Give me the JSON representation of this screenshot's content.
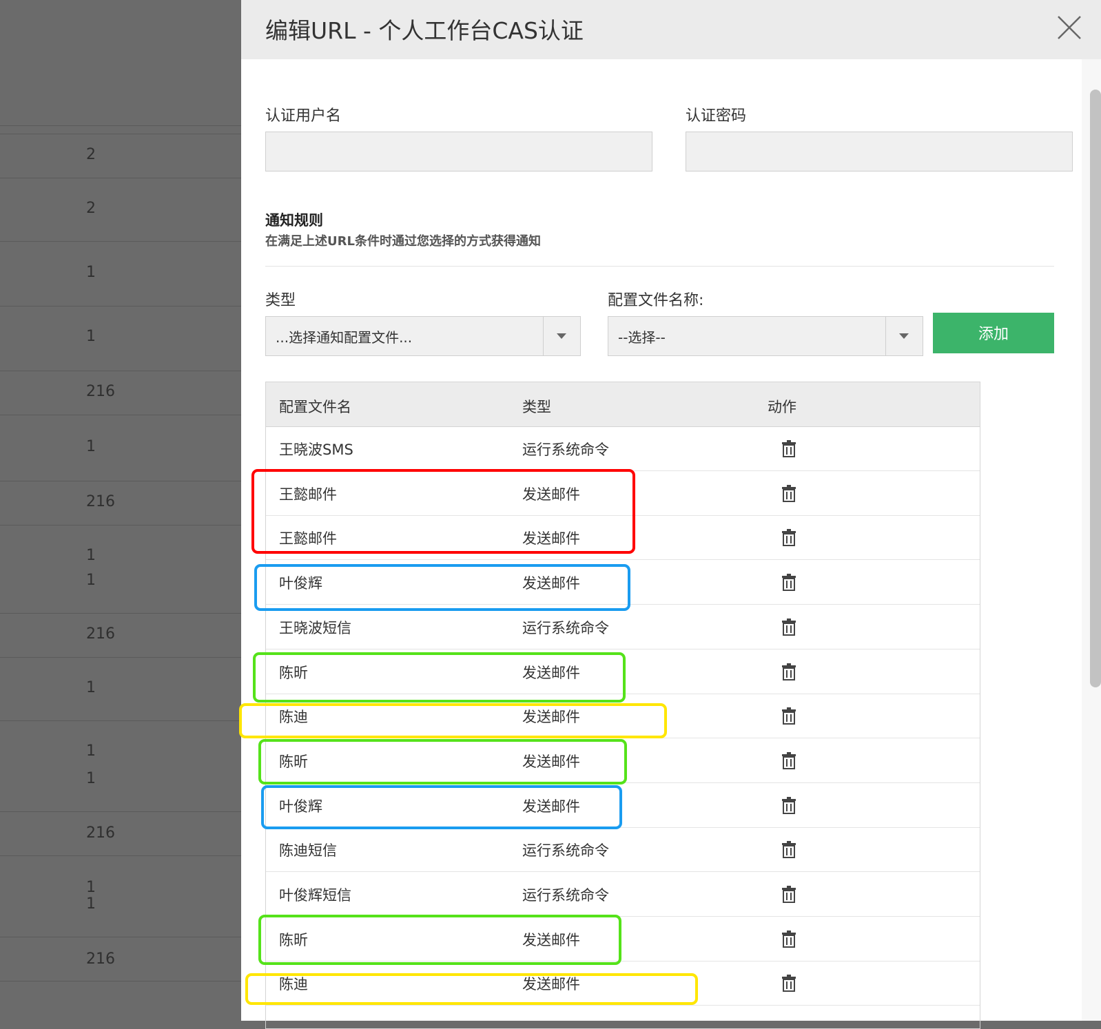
{
  "background": {
    "values": [
      "2",
      "2",
      "1",
      "1",
      "216",
      "1",
      "216",
      "1",
      "1",
      "216",
      "1",
      "1",
      "1",
      "216",
      "1",
      "1",
      "216"
    ]
  },
  "modal": {
    "title": "编辑URL - 个人工作台CAS认证",
    "close_icon": "close-icon"
  },
  "auth": {
    "username_label": "认证用户名",
    "username_value": "",
    "password_label": "认证密码",
    "password_value": ""
  },
  "notify": {
    "title": "通知规则",
    "description": "在满足上述URL条件时通过您选择的方式获得通知",
    "type_label": "类型",
    "type_selected": "...选择通知配置文件...",
    "profile_label": "配置文件名称:",
    "profile_selected": "--选择--",
    "add_label": "添加"
  },
  "table": {
    "headers": [
      "配置文件名",
      "类型",
      "动作"
    ],
    "rows": [
      {
        "name": "王晓波SMS",
        "type": "运行系统命令"
      },
      {
        "name": "王懿邮件",
        "type": "发送邮件"
      },
      {
        "name": "王懿邮件",
        "type": "发送邮件"
      },
      {
        "name": "叶俊辉",
        "type": "发送邮件"
      },
      {
        "name": "王晓波短信",
        "type": "运行系统命令"
      },
      {
        "name": "陈昕",
        "type": "发送邮件"
      },
      {
        "name": "陈迪",
        "type": "发送邮件"
      },
      {
        "name": "陈昕",
        "type": "发送邮件"
      },
      {
        "name": "叶俊辉",
        "type": "发送邮件"
      },
      {
        "name": "陈迪短信",
        "type": "运行系统命令"
      },
      {
        "name": "叶俊辉短信",
        "type": "运行系统命令"
      },
      {
        "name": "陈昕",
        "type": "发送邮件"
      },
      {
        "name": "陈迪",
        "type": "发送邮件"
      }
    ],
    "action_icon": "trash-icon"
  },
  "annotation_colors": {
    "red": "#ff0000",
    "blue": "#1a9cf0",
    "green": "#55e21a",
    "yellow": "#ffe600"
  }
}
